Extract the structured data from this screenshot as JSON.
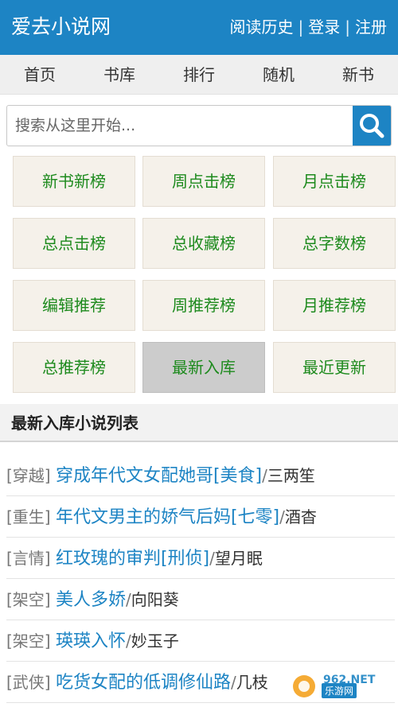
{
  "header": {
    "site_title": "爱去小说网",
    "links": [
      "阅读历史",
      "登录",
      "注册"
    ],
    "separator": "|"
  },
  "nav": {
    "items": [
      "首页",
      "书库",
      "排行",
      "随机",
      "新书"
    ]
  },
  "search": {
    "placeholder": "搜索从这里开始...",
    "button_icon": "search-icon"
  },
  "ranking": {
    "items": [
      "新书新榜",
      "周点击榜",
      "月点击榜",
      "总点击榜",
      "总收藏榜",
      "总字数榜",
      "编辑推荐",
      "周推荐榜",
      "月推荐榜",
      "总推荐榜",
      "最新入库",
      "最近更新"
    ],
    "active": "最新入库"
  },
  "section": {
    "title": "最新入库小说列表"
  },
  "list": {
    "slash": "/",
    "rows": [
      {
        "category": "[穿越]",
        "title": "穿成年代文女配她哥[美食]",
        "author": "三两笙"
      },
      {
        "category": "[重生]",
        "title": "年代文男主的娇气后妈[七零]",
        "author": "酒杳"
      },
      {
        "category": "[言情]",
        "title": "红玫瑰的审判[刑侦]",
        "author": "望月眠"
      },
      {
        "category": "[架空]",
        "title": "美人多娇",
        "author": "向阳葵"
      },
      {
        "category": "[架空]",
        "title": "瑛瑛入怀",
        "author": "妙玉子"
      },
      {
        "category": "[武侠]",
        "title": "吃货女配的低调修仙路",
        "author": "几枝"
      }
    ]
  },
  "watermark": {
    "text": "乐游网",
    "logo": "962.NET"
  },
  "colors": {
    "primary": "#1d84c4",
    "grid_text": "#1d8a1d",
    "grid_bg": "#f5f1ea",
    "grid_active_bg": "#cccccc"
  }
}
